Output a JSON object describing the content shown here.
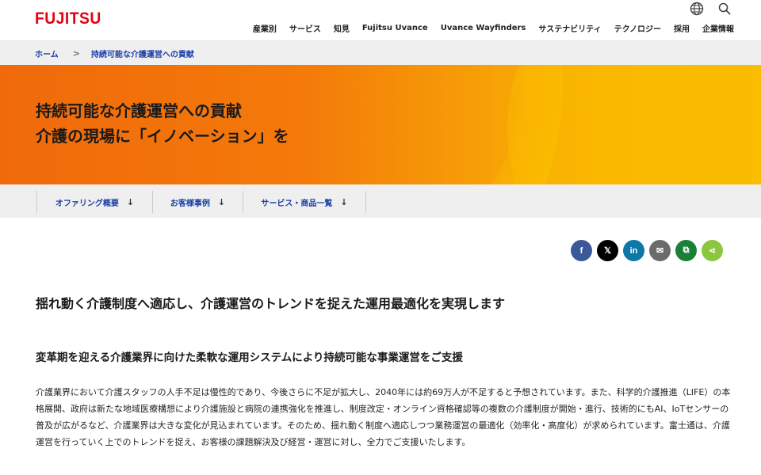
{
  "brand": {
    "logo_text": "FUJITSU",
    "logo_color": "#e60012"
  },
  "header": {
    "utility_icons": [
      "globe-icon",
      "search-icon"
    ],
    "nav": [
      "産業別",
      "サービス",
      "知見",
      "Fujitsu Uvance",
      "Uvance Wayfinders",
      "サステナビリティ",
      "テクノロジー",
      "採用",
      "企業情報"
    ]
  },
  "breadcrumb": {
    "home": "ホーム",
    "current": "持続可能な介護運営への貢献",
    "separator": ">"
  },
  "hero": {
    "line1": "持続可能な介護運営への貢献",
    "line2": "介護の現場に「イノベーション」を"
  },
  "subnav": [
    {
      "label": "オファリング概要",
      "arrow": "↓"
    },
    {
      "label": "お客様事例",
      "arrow": "↓"
    },
    {
      "label": "サービス・商品一覧",
      "arrow": "↓"
    }
  ],
  "share": [
    {
      "name": "facebook",
      "glyph": "f",
      "color": "#3b5998"
    },
    {
      "name": "x",
      "glyph": "𝕏",
      "color": "#000000"
    },
    {
      "name": "linkedin",
      "glyph": "in",
      "color": "#0e76a8"
    },
    {
      "name": "email",
      "glyph": "✉",
      "color": "#6b6b6b"
    },
    {
      "name": "copy",
      "glyph": "⧉",
      "color": "#1a7f37"
    },
    {
      "name": "share",
      "glyph": "⋖",
      "color": "#8cc63f"
    }
  ],
  "content": {
    "heading": "揺れ動く介護制度へ適応し、介護運営のトレンドを捉えた運用最適化を実現します",
    "subheading": "変革期を迎える介護業界に向けた柔軟な運用システムにより持続可能な事業運営をご支援",
    "paragraph": "介護業界において介護スタッフの人手不足は慢性的であり、今後さらに不足が拡大し、2040年には約69万人が不足すると予想されています。また、科学的介護推進（LIFE）の本格展開、政府は新たな地域医療構想により介護施設と病院の連携強化を推進し、制度改定・オンライン資格確認等の複数の介護制度が開始・進行、技術的にもAI、IoTセンサーの普及が広がるなど、介護業界は大きな変化が見込まれています。そのため、揺れ動く制度へ適応しつつ業務運営の最適化（効率化・高度化）が求められています。富士通は、介護運営を行っていく上でのトレンドを捉え、お客様の課題解決及び経営・運営に対し、全力でご支援いたします。"
  },
  "colors": {
    "link": "#1a3fa8",
    "hero_start": "#f06a0b",
    "hero_end": "#fbc100"
  }
}
